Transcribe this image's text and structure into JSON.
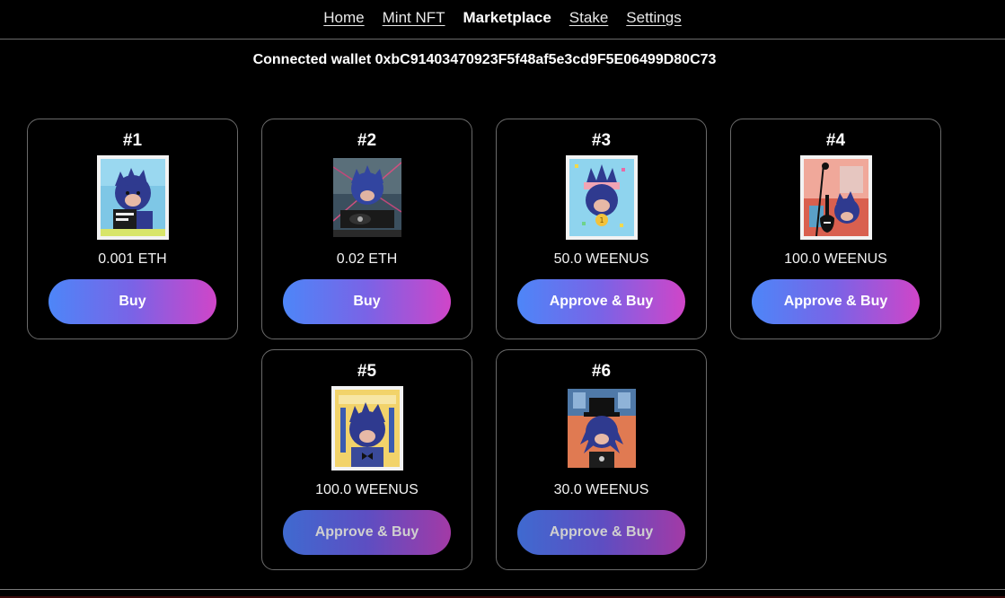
{
  "nav": {
    "items": [
      {
        "label": "Home",
        "active": false
      },
      {
        "label": "Mint NFT",
        "active": false
      },
      {
        "label": "Marketplace",
        "active": true
      },
      {
        "label": "Stake",
        "active": false
      },
      {
        "label": "Settings",
        "active": false
      }
    ]
  },
  "wallet": {
    "text": "Connected wallet 0xbC91403470923F5f48af5e3cd9F5E06499D80C73"
  },
  "cards": [
    {
      "number": "#1",
      "price": "0.001 ETH",
      "button": "Buy"
    },
    {
      "number": "#2",
      "price": "0.02 ETH",
      "button": "Buy"
    },
    {
      "number": "#3",
      "price": "50.0 WEENUS",
      "button": "Approve & Buy"
    },
    {
      "number": "#4",
      "price": "100.0 WEENUS",
      "button": "Approve & Buy"
    },
    {
      "number": "#5",
      "price": "100.0 WEENUS",
      "button": "Approve & Buy"
    },
    {
      "number": "#6",
      "price": "30.0 WEENUS",
      "button": "Approve & Buy"
    }
  ],
  "colors": {
    "background": "#000000",
    "button_gradient_start": "#4d86f8",
    "button_gradient_end": "#d045c8",
    "card_border": "#6a6a6a"
  }
}
